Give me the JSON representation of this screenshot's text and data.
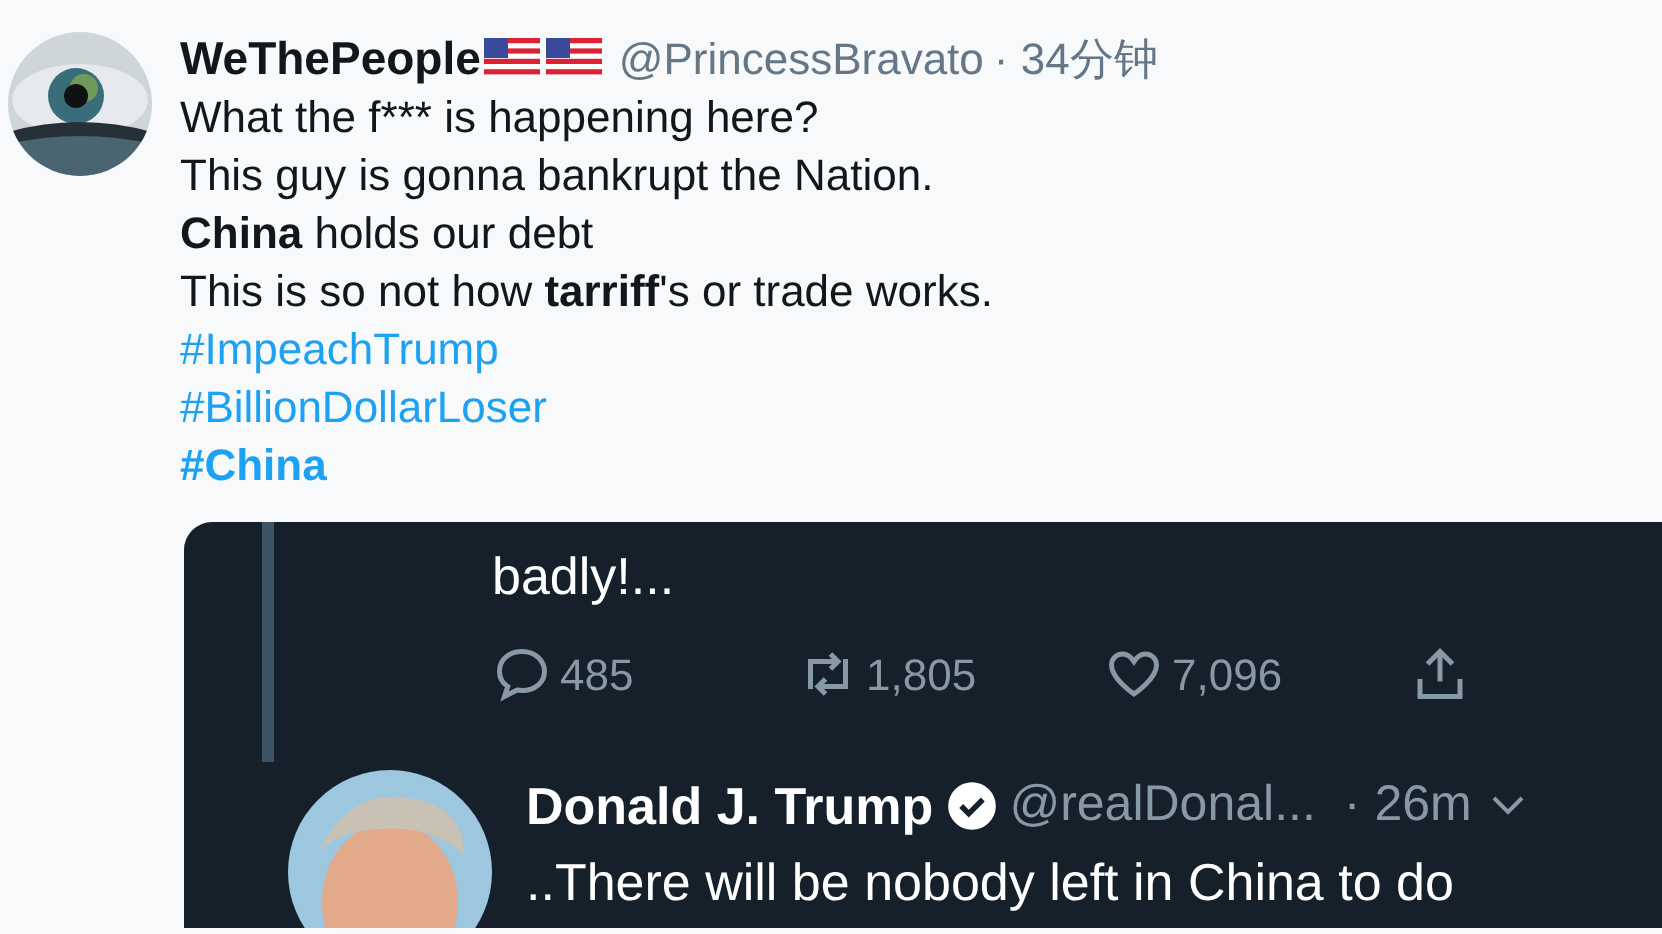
{
  "tweet": {
    "name": "WeThePeople",
    "flags": [
      {
        "kind": "us"
      },
      {
        "kind": "us"
      }
    ],
    "handle": "@PrincessBravato",
    "time": "· 34分钟",
    "lines": [
      "What the f*** is happening here?",
      "This guy is gonna bankrupt the Nation.",
      "**China** holds our debt",
      "This is so not how **tarriff**'s or trade works."
    ],
    "hashtags": [
      {
        "text": "#ImpeachTrump",
        "bold": false
      },
      {
        "text": "#BillionDollarLoser",
        "bold": false
      },
      {
        "text": "#China",
        "bold": true
      }
    ]
  },
  "embedded": {
    "text": "badly!...",
    "actions": [
      {
        "kind": "reply",
        "count": "485"
      },
      {
        "kind": "retweet",
        "count": "1,805"
      },
      {
        "kind": "like",
        "count": "7,096"
      },
      {
        "kind": "share"
      }
    ],
    "reply": {
      "name": "Donald J. Trump",
      "verified": true,
      "handle": "@realDonal...",
      "time": "· 26m",
      "text": "..There will be nobody left in China to do"
    }
  }
}
